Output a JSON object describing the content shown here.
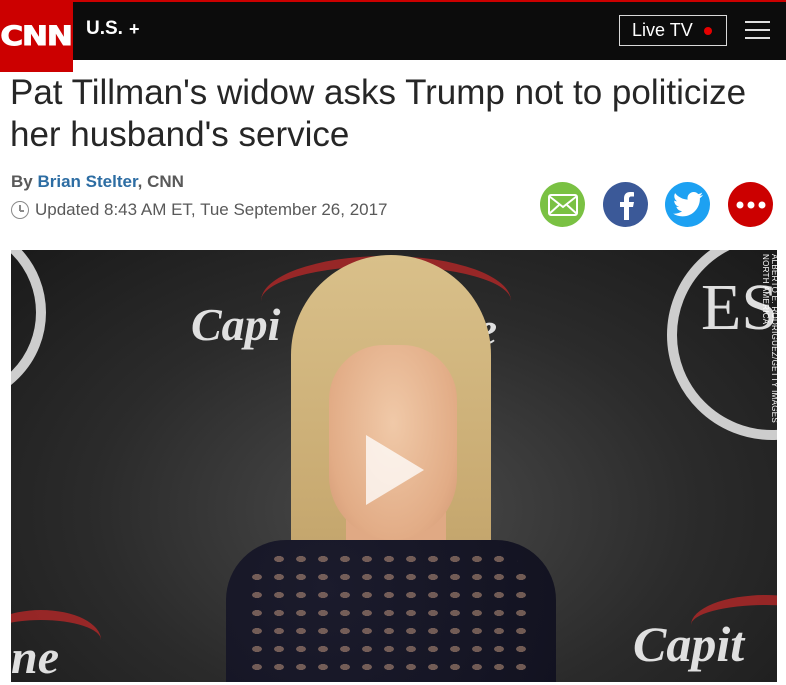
{
  "nav": {
    "logo": "CNN",
    "section": "U.S.",
    "section_expand": "+",
    "live_tv": "Live TV"
  },
  "article": {
    "headline": "Pat Tillman's widow asks Trump not to politicize her husband's service",
    "byline_prefix": "By",
    "author": "Brian Stelter",
    "byline_suffix": ", CNN",
    "timestamp": "Updated 8:43 AM ET, Tue September 26, 2017"
  },
  "share": {
    "email": "email-icon",
    "facebook": "facebook-icon",
    "twitter": "twitter-icon",
    "more": "more-icon"
  },
  "video": {
    "photo_credit": "ALBERTO E. RODRIGUEZ/GETTY IMAGES NORTH AMERICA",
    "backdrop_text_1": "Capi",
    "backdrop_text_2": "ne",
    "backdrop_text_3": "ES",
    "backdrop_text_4": "Capit",
    "backdrop_text_5": "ne"
  },
  "colors": {
    "brand_red": "#cc0000",
    "nav_bg": "#0c0c0c",
    "link_blue": "#2d6da3",
    "email_green": "#7ac143",
    "facebook_blue": "#3b5998",
    "twitter_blue": "#1da1f2"
  }
}
